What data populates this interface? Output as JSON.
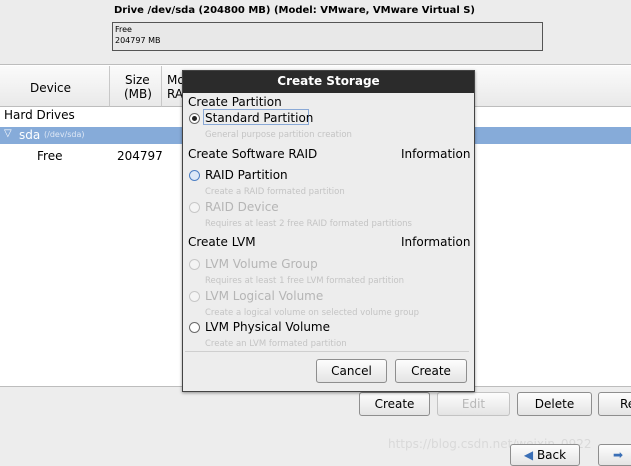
{
  "drive": {
    "title": "Drive /dev/sda (204800 MB) (Model: VMware, VMware Virtual S)",
    "free_label": "Free",
    "free_size": "204797 MB"
  },
  "table": {
    "headers": {
      "device": "Device",
      "size_line1": "Size",
      "size_line2": "(MB)",
      "mount_line1": "Mo",
      "mount_line2": "RA"
    },
    "group": "Hard Drives",
    "sda": {
      "name": "sda",
      "path": "(/dev/sda)",
      "arrow": "▽"
    },
    "free_row": {
      "label": "Free",
      "size": "204797"
    }
  },
  "dialog": {
    "title": "Create Storage",
    "section_partition": "Create Partition",
    "opt_standard": "Standard Partition",
    "desc_standard": "General purpose partition creation",
    "section_raid": "Create Software RAID",
    "info_raid": "Information",
    "opt_raid_partition": "RAID Partition",
    "desc_raid_partition": "Create a RAID formated partition",
    "opt_raid_device": "RAID Device",
    "desc_raid_device": "Requires at least 2 free RAID formated partitions",
    "section_lvm": "Create LVM",
    "info_lvm": "Information",
    "opt_lvm_vg": "LVM Volume Group",
    "desc_lvm_vg": "Requires at least 1 free LVM formated partition",
    "opt_lvm_lv": "LVM Logical Volume",
    "desc_lvm_lv": "Create a logical volume on selected volume group",
    "opt_lvm_pv": "LVM Physical Volume",
    "desc_lvm_pv": "Create an LVM formated partition",
    "cancel": "Cancel",
    "create": "Create"
  },
  "toolbar": {
    "create": "Create",
    "edit": "Edit",
    "delete": "Delete",
    "reset": "Re"
  },
  "nav": {
    "back": "Back",
    "back_icon": "◀",
    "next_icon": "➡"
  },
  "watermark": "https://blog.csdn.net/weixin_0922"
}
